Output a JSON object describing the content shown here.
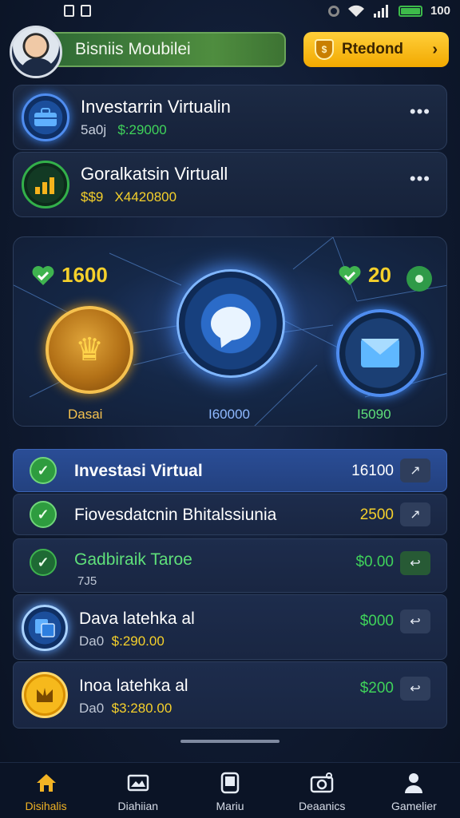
{
  "status_bar": {
    "battery_text": "100"
  },
  "header": {
    "title": "Bisniis Moubilei",
    "reward_label": "Rtedond"
  },
  "cards": [
    {
      "title": "Investarrin Virtualin",
      "sub_prefix": "5a0j",
      "sub_value": "$:29000"
    },
    {
      "title": "Goralkatsin Virtuall",
      "sub_prefix": "$$9",
      "sub_value": "X4420800"
    }
  ],
  "hero": {
    "left_stat": "1600",
    "right_stat": "20",
    "label_left": "Dasai",
    "label_center": "I60000",
    "label_right": "I5090"
  },
  "list": [
    {
      "title": "Investasi Virtual",
      "value": "16100"
    },
    {
      "title": "Fiovesdatcnin Bhitalssiunia",
      "value": "2500"
    },
    {
      "title": "Gadbiraik Taroe",
      "sub": "7J5",
      "value": "$0.00"
    },
    {
      "title": "Dava latehka al",
      "sub_prefix": "Da0",
      "sub_value": "$:290.00",
      "value": "$000"
    },
    {
      "title": "Inoa latehka al",
      "sub_prefix": "Da0",
      "sub_value": "$3:280.00",
      "value": "$200"
    }
  ],
  "nav": [
    {
      "label": "Disihalis"
    },
    {
      "label": "Diahiian"
    },
    {
      "label": "Mariu"
    },
    {
      "label": "Deaanics"
    },
    {
      "label": "Gamelier"
    }
  ],
  "colors": {
    "accent": "#f2b324",
    "green": "#3fd35a",
    "yellow": "#f5d02b",
    "bg": "#0f1a30"
  },
  "icons": [
    "briefcase-icon",
    "chart-icon",
    "heart-check-icon",
    "crown-icon",
    "chat-bubble-icon",
    "envelope-icon",
    "check-icon",
    "arrow-icon",
    "home-icon",
    "image-icon",
    "tablet-icon",
    "camera-icon",
    "user-icon"
  ]
}
